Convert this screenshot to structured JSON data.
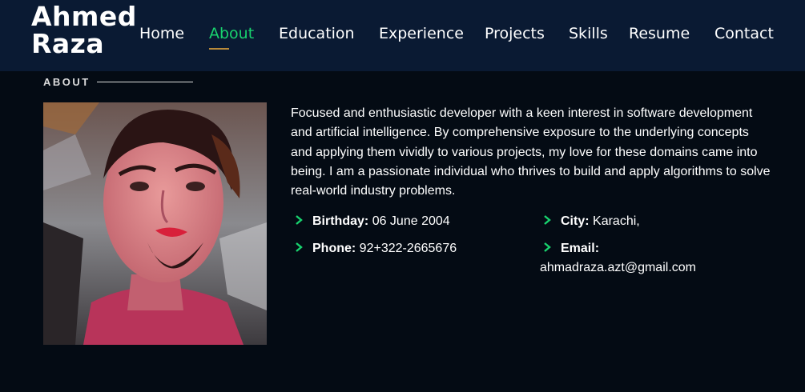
{
  "header": {
    "logo_line1": "Ahmed",
    "logo_line2": "Raza",
    "nav": [
      {
        "label": "Home",
        "active": false
      },
      {
        "label": "About",
        "active": true
      },
      {
        "label": "Education",
        "active": false
      },
      {
        "label": "Experience",
        "active": false
      },
      {
        "label": "Projects",
        "active": false
      },
      {
        "label": "Skills",
        "active": false
      },
      {
        "label": "Resume",
        "active": false
      },
      {
        "label": "Contact",
        "active": false
      }
    ]
  },
  "about": {
    "section_title": "ABOUT",
    "bio": "Focused and enthusiastic developer with a keen interest in software development and artificial intelligence. By comprehensive exposure to the underlying concepts and applying them vividly to various projects, my love for these domains came into being. I am a passionate individual who thrives to build and apply algorithms to solve real-world industry problems.",
    "details": {
      "birthday_label": "Birthday:",
      "birthday_value": "06 June 2004",
      "city_label": "City:",
      "city_value": "Karachi,",
      "phone_label": "Phone:",
      "phone_value": "92+322-2665676",
      "email_label": "Email:",
      "email_value": "ahmadraza.azt@gmail.com"
    }
  },
  "colors": {
    "header_bg": "#0a1a33",
    "page_bg": "#040b14",
    "accent": "#18d26e",
    "underline": "#b88a3a"
  },
  "icons": {
    "bullet": "chevron-right-icon",
    "profile": "profile-photo"
  }
}
